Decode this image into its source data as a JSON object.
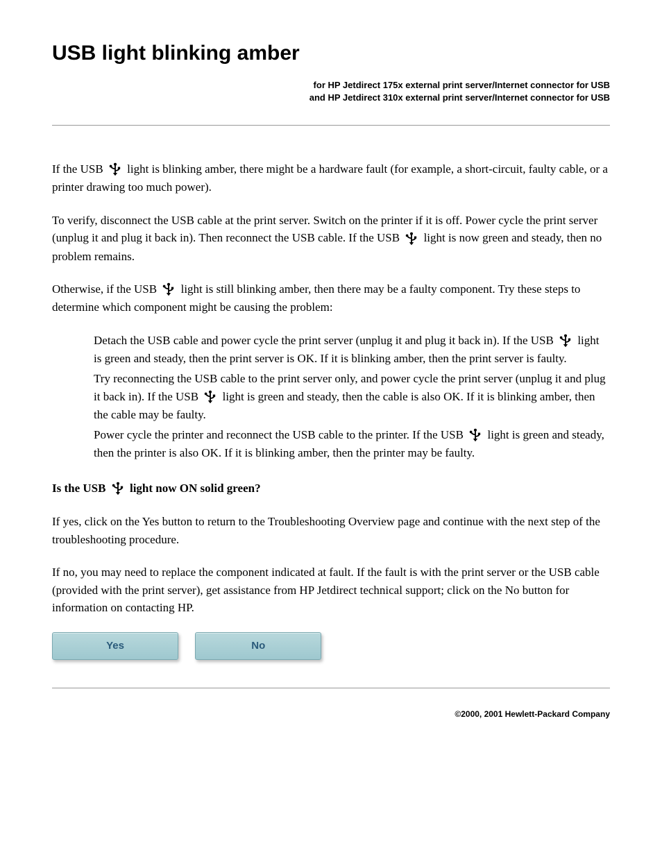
{
  "title": "USB light blinking amber",
  "subtitle_line1": "for HP Jetdirect 175x external print server/Internet connector for USB",
  "subtitle_line2": "and HP Jetdirect 310x external print server/Internet connector for USB",
  "para1_a": "If the USB ",
  "para1_b": " light is blinking amber, there might be a hardware fault (for example, a short-circuit, faulty cable, or a printer drawing too much power).",
  "para2_a": "To verify, disconnect the USB cable at the print server. Switch on the printer if it is off. Power cycle the print server (unplug it and plug it back in). Then reconnect the USB cable. If the USB ",
  "para2_b": " light is now green and steady, then no problem remains.",
  "para3_a": "Otherwise, if the USB ",
  "para3_b": " light is still blinking amber, then there may be a faulty component. Try these steps to determine which component might be causing the problem:",
  "step1_a": "Detach the USB cable and power cycle the print server (unplug it and plug it back in). If the USB ",
  "step1_b": " light is green and steady, then the print server is OK. If it is blinking amber, then the print server is faulty.",
  "step2_a": "Try reconnecting the USB cable to the print server only, and power cycle the print server (unplug it and plug it back in). If the USB ",
  "step2_b": " light is green and steady, then the cable is also OK. If it is blinking amber, then the cable may be faulty.",
  "step3_a": "Power cycle the printer and reconnect the USB cable to the printer. If the USB ",
  "step3_b": " light is green and steady, then the printer is also OK. If it is blinking amber, then the printer may be faulty.",
  "question_a": "Is the USB ",
  "question_b": " light now ON solid green?",
  "para_yes": "If yes, click on the Yes button to return to the Troubleshooting Overview page and continue with the next step of the troubleshooting procedure.",
  "para_no": "If no, you may need to replace the component indicated at fault. If the fault is with the print server or the USB cable (provided with the print server), get assistance from HP Jetdirect technical support; click on the No button for information on contacting HP.",
  "btn_yes": "Yes",
  "btn_no": "No",
  "copyright": "©2000, 2001 Hewlett-Packard Company"
}
